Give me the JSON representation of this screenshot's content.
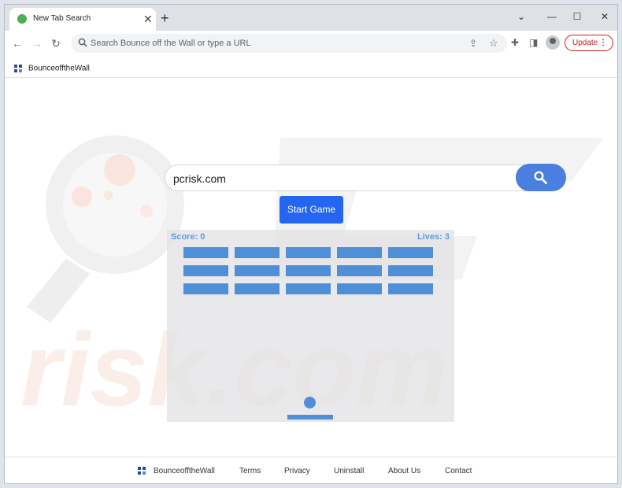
{
  "tab": {
    "title": "New Tab Search",
    "close_glyph": "✕",
    "new_tab_glyph": "+"
  },
  "window_controls": {
    "minimize": "⌄",
    "restore": "—",
    "maximize": "☐",
    "close": "✕"
  },
  "toolbar": {
    "back_glyph": "←",
    "forward_glyph": "→",
    "reload_glyph": "↻",
    "omnibox_placeholder": "Search Bounce off the Wall or type a URL",
    "share_glyph": "⇪",
    "star_glyph": "☆",
    "extensions_glyph": "✚",
    "sidepanel_glyph": "◨",
    "update_label": "Update",
    "menu_glyph": "⋮"
  },
  "bookmarks": {
    "item_label": "BounceofftheWall"
  },
  "search": {
    "value": "pcrisk.com"
  },
  "game": {
    "start_label": "Start Game",
    "score_text": "Score: 0",
    "lives_text": "Lives: 3",
    "bricks": {
      "rows": 3,
      "cols": 5
    }
  },
  "footer": {
    "brand": "BounceofftheWall",
    "links": [
      "Terms",
      "Privacy",
      "Uninstall",
      "About Us",
      "Contact"
    ]
  },
  "colors": {
    "accent": "#2566f0",
    "search_button": "#4a7fe0",
    "game_blue": "#4f8fd8",
    "update_red": "#c5221f"
  },
  "icons": [
    "search-icon",
    "star-icon",
    "puzzle-icon",
    "sidepanel-icon",
    "profile-icon",
    "kebab-icon"
  ]
}
